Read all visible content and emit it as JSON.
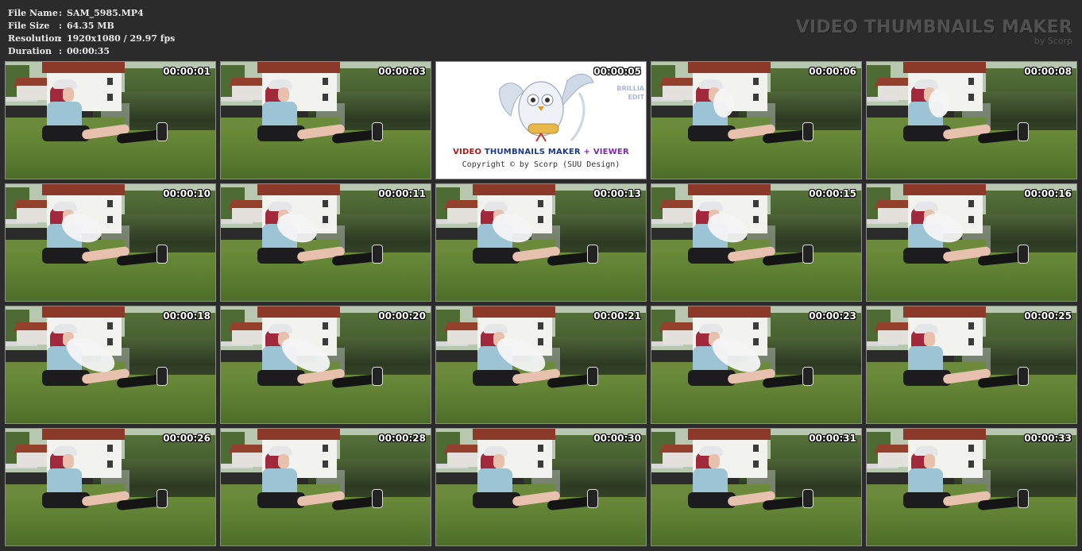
{
  "file_info": [
    {
      "key": "File Name",
      "sep": ":",
      "value": "SAM_5985.MP4"
    },
    {
      "key": "File Size",
      "sep": ":",
      "value": "64.35 MB"
    },
    {
      "key": "Resolution",
      "sep": ":",
      "value": "1920x1080 / 29.97 fps"
    },
    {
      "key": "Duration",
      "sep": ":",
      "value": "00:00:35"
    }
  ],
  "brand": {
    "title": "VIDEO THUMBNAILS MAKER",
    "subtitle": "by Scorp"
  },
  "logo_card": {
    "title_part1": "VIDEO",
    "title_part2": "THUMBNAILS MAKER",
    "title_plus": "+",
    "title_part3": "VIEWER",
    "copyright": "Copyright © by Scorp (SUU Design)",
    "brilliant_line1": "BRILLIA",
    "brilliant_line2": "EDIT",
    "colors": {
      "video": "#b01818",
      "thumbs": "#1a3a8a",
      "viewer": "#7a2aa8"
    }
  },
  "thumbnails": [
    {
      "time": "00:00:01",
      "balloon": "none"
    },
    {
      "time": "00:00:03",
      "balloon": "none"
    },
    {
      "time": "00:00:05",
      "balloon": "logo"
    },
    {
      "time": "00:00:06",
      "balloon": "small"
    },
    {
      "time": "00:00:08",
      "balloon": "small"
    },
    {
      "time": "00:00:10",
      "balloon": "medium"
    },
    {
      "time": "00:00:11",
      "balloon": "medium"
    },
    {
      "time": "00:00:13",
      "balloon": "medium"
    },
    {
      "time": "00:00:15",
      "balloon": "medium"
    },
    {
      "time": "00:00:16",
      "balloon": "medium"
    },
    {
      "time": "00:00:18",
      "balloon": "large"
    },
    {
      "time": "00:00:20",
      "balloon": "large"
    },
    {
      "time": "00:00:21",
      "balloon": "large"
    },
    {
      "time": "00:00:23",
      "balloon": "large"
    },
    {
      "time": "00:00:25",
      "balloon": "none"
    },
    {
      "time": "00:00:26",
      "balloon": "none"
    },
    {
      "time": "00:00:28",
      "balloon": "none"
    },
    {
      "time": "00:00:30",
      "balloon": "none"
    },
    {
      "time": "00:00:31",
      "balloon": "none"
    },
    {
      "time": "00:00:33",
      "balloon": "none"
    }
  ]
}
